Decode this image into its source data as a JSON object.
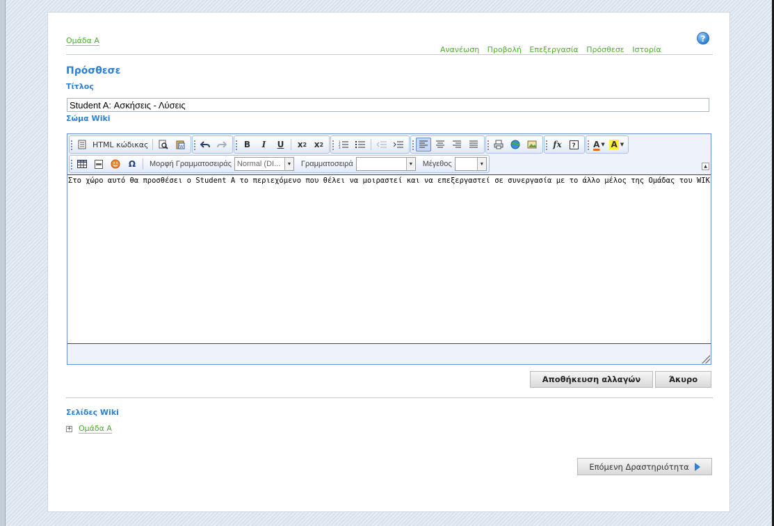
{
  "header": {
    "group_link": "Ομάδα Α",
    "help_glyph": "?",
    "nav": [
      "Ανανέωση",
      "Προβολή",
      "Επεξεργασία",
      "Πρόσθεσε",
      "Ιστορία"
    ]
  },
  "page": {
    "heading": "Πρόσθεσε",
    "title_label": "Τίτλος",
    "title_value": "Student A: Ασκήσεις - Λύσεις",
    "body_label": "Σώμα Wiki"
  },
  "toolbar": {
    "html_code": "HTML κώδικας",
    "bold": "B",
    "italic": "I",
    "underline": "U",
    "subscript": "x",
    "superscript": "x",
    "subscript_mark": "2",
    "superscript_mark": "2",
    "format_label": "Μορφή Γραμματοσειράς",
    "format_value": "Normal (DI...",
    "font_label": "Γραμματοσειρά",
    "font_value": "",
    "size_label": "Μέγεθος",
    "size_value": "",
    "special_char": "Ω",
    "formula": "fx",
    "text_color": "A",
    "bg_color": "A",
    "icons": [
      "source-icon",
      "preview-icon",
      "paste-word-icon",
      "undo-icon",
      "redo-icon",
      "ordered-list-icon",
      "unordered-list-icon",
      "outdent-icon",
      "indent-icon",
      "align-left-icon",
      "align-center-icon",
      "align-right-icon",
      "justify-icon",
      "print-icon",
      "link-icon",
      "image-icon",
      "remove-format-icon",
      "help-icon",
      "table-icon",
      "horizontal-rule-icon",
      "smiley-icon",
      "special-char-icon"
    ]
  },
  "editor": {
    "content": "Στο χώρο αυτό θα προσθέσει ο Student A το περιεχόμενο που θέλει να μοιραστεί και να επεξεργαστεί σε συνεργασία με το άλλο μέλος της Ομάδας του WIKI."
  },
  "actions": {
    "save": "Αποθήκευση αλλαγών",
    "cancel": "Άκυρο"
  },
  "wiki_pages": {
    "label": "Σελίδες Wiki",
    "items": [
      "Ομάδα Α"
    ]
  },
  "next": {
    "label": "Επόμενη Δραστηριότητα"
  },
  "colors": {
    "link_green": "#4caf2a",
    "heading_blue": "#2d7fd0",
    "editor_border": "#6b8fd6"
  }
}
